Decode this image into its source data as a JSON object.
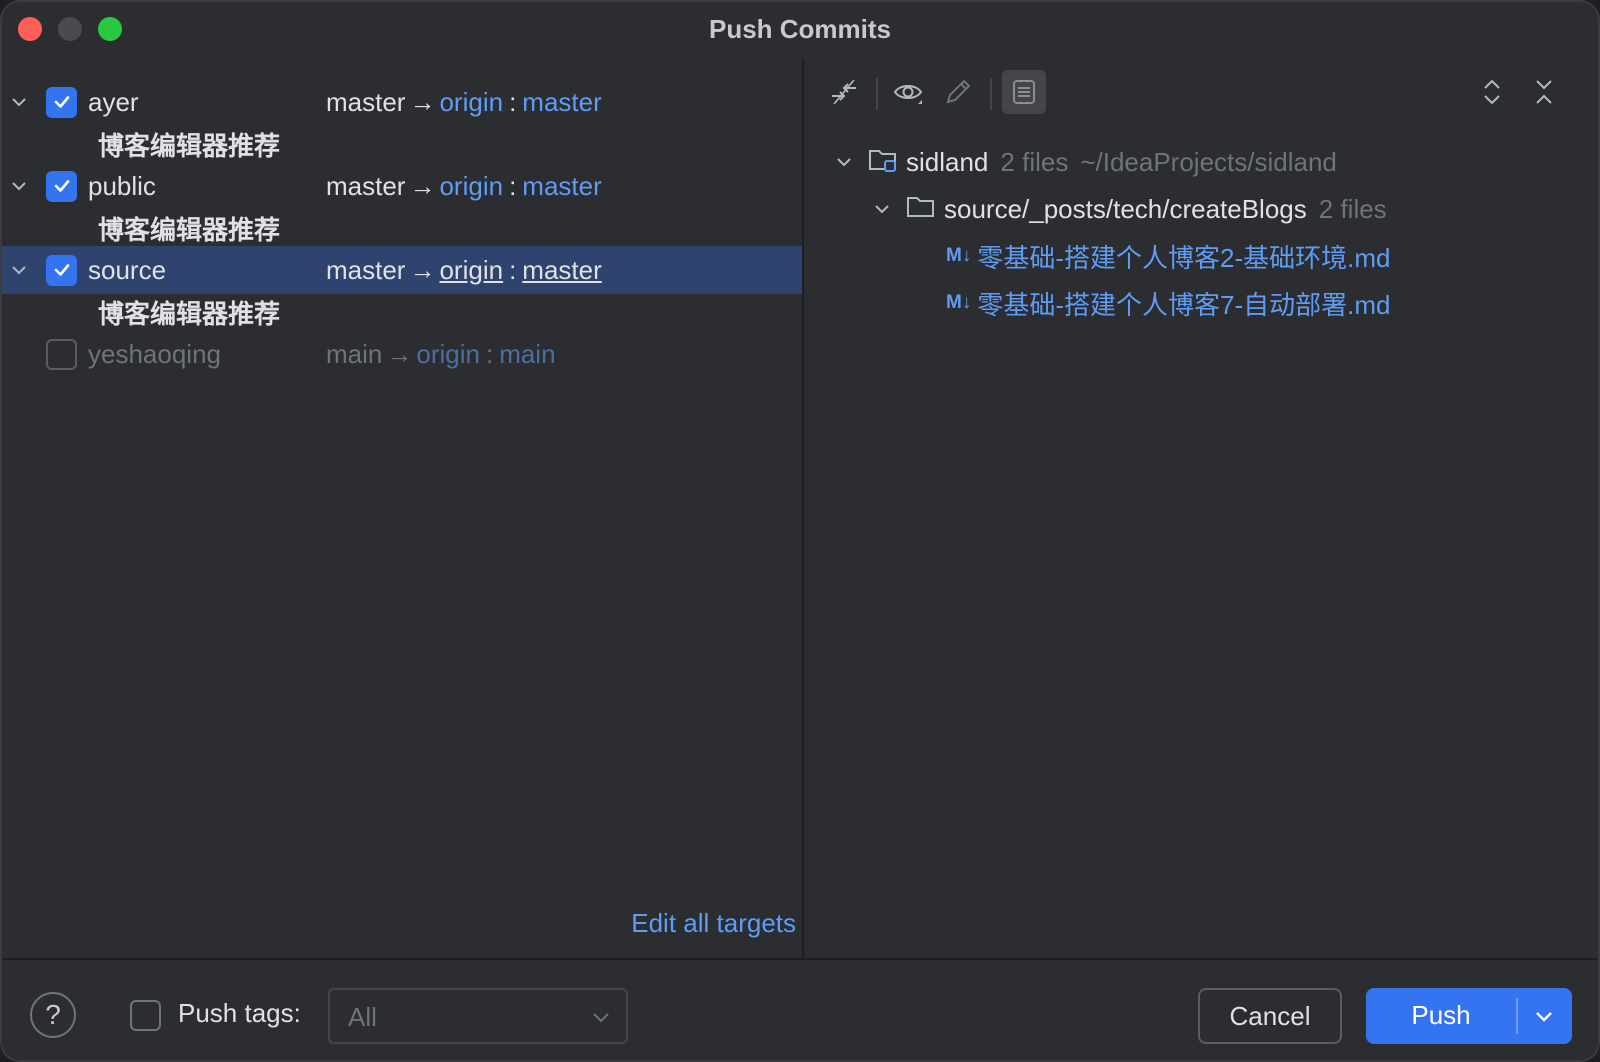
{
  "window": {
    "title": "Push Commits"
  },
  "repos": [
    {
      "name": "ayer",
      "checked": true,
      "local_branch": "master",
      "remote": "origin",
      "remote_branch": "master",
      "commit": "博客编辑器推荐"
    },
    {
      "name": "public",
      "checked": true,
      "local_branch": "master",
      "remote": "origin",
      "remote_branch": "master",
      "commit": "博客编辑器推荐"
    },
    {
      "name": "source",
      "checked": true,
      "selected": true,
      "local_branch": "master",
      "remote": "origin",
      "remote_branch": "master",
      "commit": "博客编辑器推荐"
    },
    {
      "name": "yeshaoqing",
      "checked": false,
      "local_branch": "main",
      "remote": "origin",
      "remote_branch": "main"
    }
  ],
  "arrow": "→",
  "separator": ":",
  "edit_all_targets": "Edit all targets",
  "changes": {
    "root": {
      "name": "sidland",
      "count": "2 files",
      "path": "~/IdeaProjects/sidland"
    },
    "folder": {
      "name": "source/_posts/tech/createBlogs",
      "count": "2 files"
    },
    "md_badge": "M↓",
    "files": [
      "零基础-搭建个人博客2-基础环境.md",
      "零基础-搭建个人博客7-自动部署.md"
    ]
  },
  "toolbar_icons": [
    "compare-icon",
    "eye-icon",
    "pencil-icon",
    "list-icon",
    "expand-all-icon",
    "collapse-all-icon"
  ],
  "footer": {
    "help": "?",
    "push_tags_label": "Push tags:",
    "push_tags_value": "All",
    "cancel_label": "Cancel",
    "push_label": "Push"
  },
  "colors": {
    "accent": "#3574f0",
    "link": "#5e9cf5",
    "selection": "#2e436e",
    "background": "#2b2d30"
  }
}
